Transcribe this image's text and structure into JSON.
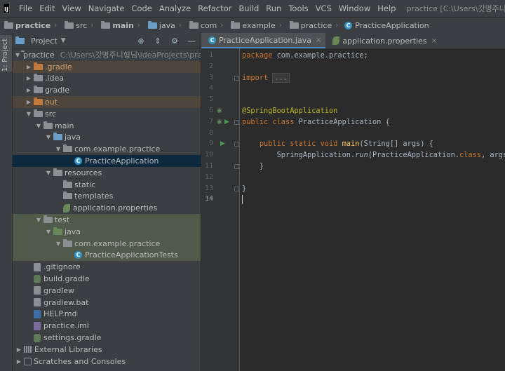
{
  "menubar": {
    "app_icon_label": "IJ",
    "items": [
      "File",
      "Edit",
      "View",
      "Navigate",
      "Code",
      "Analyze",
      "Refactor",
      "Build",
      "Run",
      "Tools",
      "VCS",
      "Window",
      "Help"
    ],
    "window_title": "practice [C:\\Users\\갓명주니형님\\ideaProjects\\practice]"
  },
  "breadcrumbs": [
    "practice",
    "src",
    "main",
    "java",
    "com",
    "example",
    "practice",
    "PracticeApplication"
  ],
  "left_strip": {
    "label": "1: Project"
  },
  "project_pane": {
    "title": "Project",
    "dropdown_icon": "chevron-down-icon",
    "tool_icons": [
      "target-icon",
      "collapse-icon",
      "gear-icon",
      "hide-icon"
    ]
  },
  "tree": [
    {
      "label": "practice",
      "path": "C:\\Users\\갓명주니형님\\ideaProjects\\practice",
      "indent": 0,
      "expanded": true,
      "icon": "folder"
    },
    {
      "label": ".gradle",
      "indent": 1,
      "expanded": false,
      "icon": "folder-orange",
      "excluded": true
    },
    {
      "label": ".idea",
      "indent": 1,
      "expanded": false,
      "icon": "folder"
    },
    {
      "label": "gradle",
      "indent": 1,
      "expanded": false,
      "icon": "folder"
    },
    {
      "label": "out",
      "indent": 1,
      "expanded": false,
      "icon": "folder-orange",
      "excluded": true
    },
    {
      "label": "src",
      "indent": 1,
      "expanded": true,
      "icon": "folder"
    },
    {
      "label": "main",
      "indent": 2,
      "expanded": true,
      "icon": "folder"
    },
    {
      "label": "java",
      "indent": 3,
      "expanded": true,
      "icon": "folder-blue"
    },
    {
      "label": "com.example.practice",
      "indent": 4,
      "expanded": true,
      "icon": "folder"
    },
    {
      "label": "PracticeApplication",
      "indent": 5,
      "icon": "class",
      "selected": true
    },
    {
      "label": "resources",
      "indent": 3,
      "expanded": true,
      "icon": "folder-res"
    },
    {
      "label": "static",
      "indent": 4,
      "icon": "folder"
    },
    {
      "label": "templates",
      "indent": 4,
      "icon": "folder"
    },
    {
      "label": "application.properties",
      "indent": 4,
      "icon": "leaf"
    },
    {
      "label": "test",
      "indent": 2,
      "expanded": true,
      "icon": "folder",
      "test": true
    },
    {
      "label": "java",
      "indent": 3,
      "expanded": true,
      "icon": "folder-green",
      "test": true
    },
    {
      "label": "com.example.practice",
      "indent": 4,
      "expanded": true,
      "icon": "folder",
      "test": true
    },
    {
      "label": "PracticeApplicationTests",
      "indent": 5,
      "icon": "class",
      "test": true
    },
    {
      "label": ".gitignore",
      "indent": 1,
      "icon": "file"
    },
    {
      "label": "build.gradle",
      "indent": 1,
      "icon": "gradle"
    },
    {
      "label": "gradlew",
      "indent": 1,
      "icon": "file"
    },
    {
      "label": "gradlew.bat",
      "indent": 1,
      "icon": "file"
    },
    {
      "label": "HELP.md",
      "indent": 1,
      "icon": "doc"
    },
    {
      "label": "practice.iml",
      "indent": 1,
      "icon": "xml"
    },
    {
      "label": "settings.gradle",
      "indent": 1,
      "icon": "gradle"
    },
    {
      "label": "External Libraries",
      "indent": 0,
      "expanded": false,
      "icon": "libs"
    },
    {
      "label": "Scratches and Consoles",
      "indent": 0,
      "expanded": false,
      "icon": "scratch"
    }
  ],
  "editor": {
    "tabs": [
      {
        "label": "PracticeApplication.java",
        "active": true,
        "icon": "class"
      },
      {
        "label": "application.properties",
        "active": false,
        "icon": "leaf"
      }
    ],
    "close_glyph": "×",
    "current_line": 14,
    "line_count": 14,
    "gutter_icons": [
      {
        "line": 6,
        "icon": "spring-bean-icon",
        "glyph": "◉"
      },
      {
        "line": 7,
        "icon": "spring-bean-icon",
        "glyph": "◉"
      },
      {
        "line": 7,
        "icon": "run-icon",
        "glyph": "▶"
      },
      {
        "line": 9,
        "icon": "run-icon",
        "glyph": "▶"
      }
    ],
    "fold_lines": [
      3,
      7,
      9,
      11,
      13
    ],
    "lines": [
      [
        {
          "t": "package ",
          "c": "kw"
        },
        {
          "t": "com.example.practice;"
        }
      ],
      [],
      [
        {
          "t": "import ",
          "c": "kw"
        },
        {
          "t": "...",
          "c": "fold-box"
        }
      ],
      [],
      [],
      [
        {
          "t": "@SpringBootApplication",
          "c": "ann"
        }
      ],
      [
        {
          "t": "public class ",
          "c": "kw"
        },
        {
          "t": "PracticeApplication {"
        }
      ],
      [],
      [
        {
          "t": "    "
        },
        {
          "t": "public static void ",
          "c": "kw"
        },
        {
          "t": "main",
          "c": "fn"
        },
        {
          "t": "(String[] args) {"
        }
      ],
      [
        {
          "t": "        SpringApplication."
        },
        {
          "t": "run",
          "c": "it"
        },
        {
          "t": "(PracticeApplication."
        },
        {
          "t": "class",
          "c": "kw"
        },
        {
          "t": ", args);"
        }
      ],
      [
        {
          "t": "    }"
        }
      ],
      [],
      [
        {
          "t": "}"
        }
      ],
      []
    ]
  }
}
